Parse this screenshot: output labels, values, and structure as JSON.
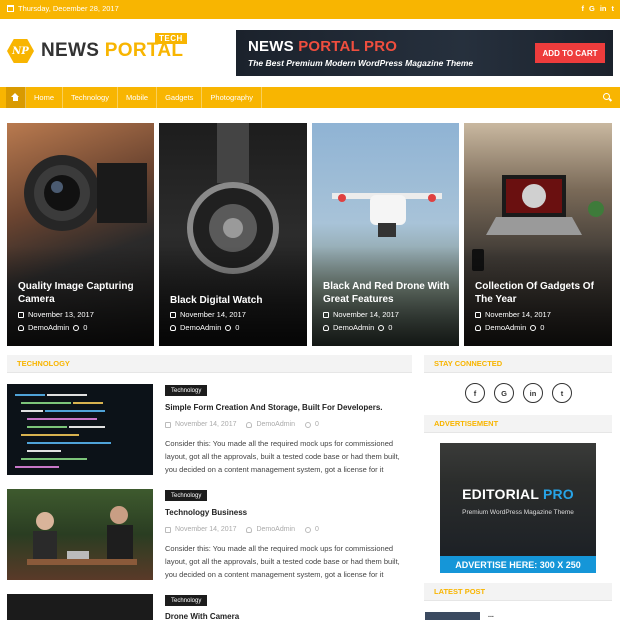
{
  "topbar": {
    "date": "Thursday, December 28, 2017",
    "social": [
      "f",
      "G",
      "in",
      "t"
    ],
    "social_icons": [
      "facebook-icon",
      "google-plus-icon",
      "linkedin-icon",
      "twitter-icon"
    ]
  },
  "header": {
    "logo_initials": "NP",
    "logo_word1": "NEWS",
    "logo_word2": "PORTAL",
    "logo_tag": "TECH",
    "banner": {
      "title_1": "NEWS",
      "title_2": "PORTAL PRO",
      "subtitle": "The Best Premium Modern WordPress Magazine Theme",
      "cta": "ADD TO CART"
    }
  },
  "nav": {
    "items": [
      "Home",
      "Technology",
      "Mobile",
      "Gadgets",
      "Photography"
    ]
  },
  "featured": [
    {
      "title": "Quality Image Capturing Camera",
      "date": "November 13, 2017",
      "author": "DemoAdmin",
      "comments": "0"
    },
    {
      "title": "Black Digital Watch",
      "date": "November 14, 2017",
      "author": "DemoAdmin",
      "comments": "0"
    },
    {
      "title": "Black And Red Drone With Great Features",
      "date": "November 14, 2017",
      "author": "DemoAdmin",
      "comments": "0"
    },
    {
      "title": "Collection Of Gadgets Of The Year",
      "date": "November 14, 2017",
      "author": "DemoAdmin",
      "comments": "0"
    }
  ],
  "technology": {
    "heading": "TECHNOLOGY",
    "posts": [
      {
        "category": "Technology",
        "title": "Simple Form Creation And Storage, Built For Developers.",
        "date": "November 14, 2017",
        "author": "DemoAdmin",
        "comments": "0",
        "excerpt_1": "Consider this: You made all the required mock ups for commissioned",
        "excerpt_2": "layout, got all the approvals, built a tested code base or had them built,",
        "excerpt_3": "you decided on a content management system, got a license for it"
      },
      {
        "category": "Technology",
        "title": "Technology Business",
        "date": "November 14, 2017",
        "author": "DemoAdmin",
        "comments": "0",
        "excerpt_1": "Consider this: You made all the required mock ups for commissioned",
        "excerpt_2": "layout, got all the approvals, built a tested code base or had them built,",
        "excerpt_3": "you decided on a content management system, got a license for it"
      },
      {
        "category": "Technology",
        "title": "Drone With Camera"
      }
    ]
  },
  "sidebar": {
    "stay_connected": "STAY CONNECTED",
    "social": [
      "f",
      "G",
      "in",
      "t"
    ],
    "advertisement": "ADVERTISEMENT",
    "ad": {
      "title_1": "EDITORIAL",
      "title_2": "PRO",
      "subtitle": "Premium WordPress Magazine Theme",
      "cta": "ADVERTISE HERE: 300 X 250"
    },
    "latest_post": "LATEST POST",
    "latest_title": "..."
  },
  "colors": {
    "accent": "#f8b501",
    "banner_bg": "#1f2732",
    "cart": "#ee3c3c",
    "ad_blue": "#1596d8"
  }
}
